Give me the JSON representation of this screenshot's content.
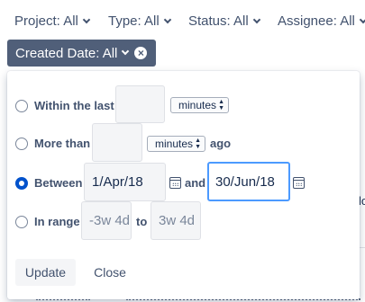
{
  "filters": [
    {
      "label": "Project: All"
    },
    {
      "label": "Type: All"
    },
    {
      "label": "Status: All"
    },
    {
      "label": "Assignee: All"
    }
  ],
  "active_filter": {
    "label": "Created Date: All",
    "clear_icon": "close-circle-icon"
  },
  "date_panel": {
    "within": {
      "label": "Within the last",
      "value": "",
      "unit": "minutes"
    },
    "more_than": {
      "label": "More than",
      "value": "",
      "unit": "minutes",
      "suffix": "ago"
    },
    "between": {
      "label": "Between",
      "from": "1/Apr/18",
      "joiner": "and",
      "to": "30/Jun/18",
      "selected": true
    },
    "in_range": {
      "label": "In range",
      "from_placeholder": "-3w 4d",
      "joiner": "to",
      "to_placeholder": "3w 4d"
    },
    "update_label": "Update",
    "close_label": "Close"
  },
  "background": {
    "partial_text": "lo"
  },
  "colors": {
    "accent": "#0052cc",
    "chip": "#505f79",
    "focus": "#4c9aff"
  }
}
